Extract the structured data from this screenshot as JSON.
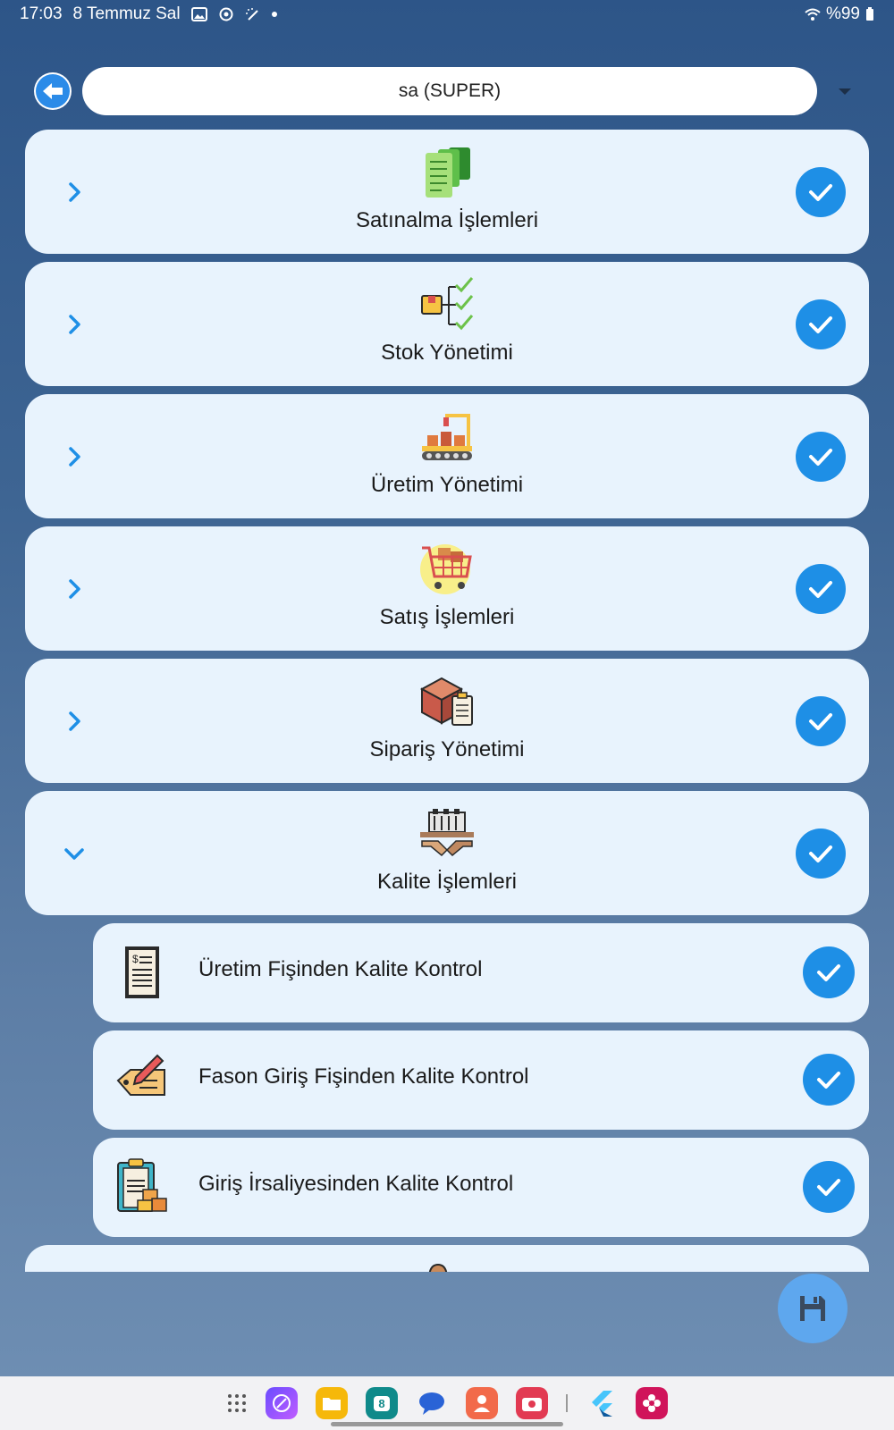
{
  "status_bar": {
    "time": "17:03",
    "date": "8 Temmuz Sal",
    "battery": "%99"
  },
  "header": {
    "user": "sa (SUPER)"
  },
  "modules": [
    {
      "label": "Satınalma İşlemleri",
      "icon": "purchase-docs-icon",
      "expanded": false,
      "checked": true
    },
    {
      "label": "Stok Yönetimi",
      "icon": "stock-tree-icon",
      "expanded": false,
      "checked": true
    },
    {
      "label": "Üretim Yönetimi",
      "icon": "production-line-icon",
      "expanded": false,
      "checked": true
    },
    {
      "label": "Satış İşlemleri",
      "icon": "shopping-cart-icon",
      "expanded": false,
      "checked": true
    },
    {
      "label": "Sipariş Yönetimi",
      "icon": "order-box-icon",
      "expanded": false,
      "checked": true
    },
    {
      "label": "Kalite İşlemleri",
      "icon": "quality-handshake-icon",
      "expanded": true,
      "checked": true
    }
  ],
  "quality_sub_items": [
    {
      "label": "Üretim Fişinden Kalite Kontrol",
      "icon": "receipt-icon",
      "checked": true
    },
    {
      "label": "Fason Giriş Fişinden Kalite Kontrol",
      "icon": "sign-document-icon",
      "checked": true
    },
    {
      "label": "Giriş İrsaliyesinden Kalite Kontrol",
      "icon": "clipboard-boxes-icon",
      "checked": true
    }
  ],
  "colors": {
    "accent": "#1e8fe6",
    "card_bg": "#e8f3fd",
    "fab": "#5ea7ee"
  },
  "taskbar_apps": [
    "apps-grid-icon",
    "browser-icon",
    "files-icon",
    "calendar-icon",
    "messages-icon",
    "contacts-icon",
    "camera-icon",
    "flutter-icon",
    "gallery-icon"
  ],
  "calendar_day": "8"
}
